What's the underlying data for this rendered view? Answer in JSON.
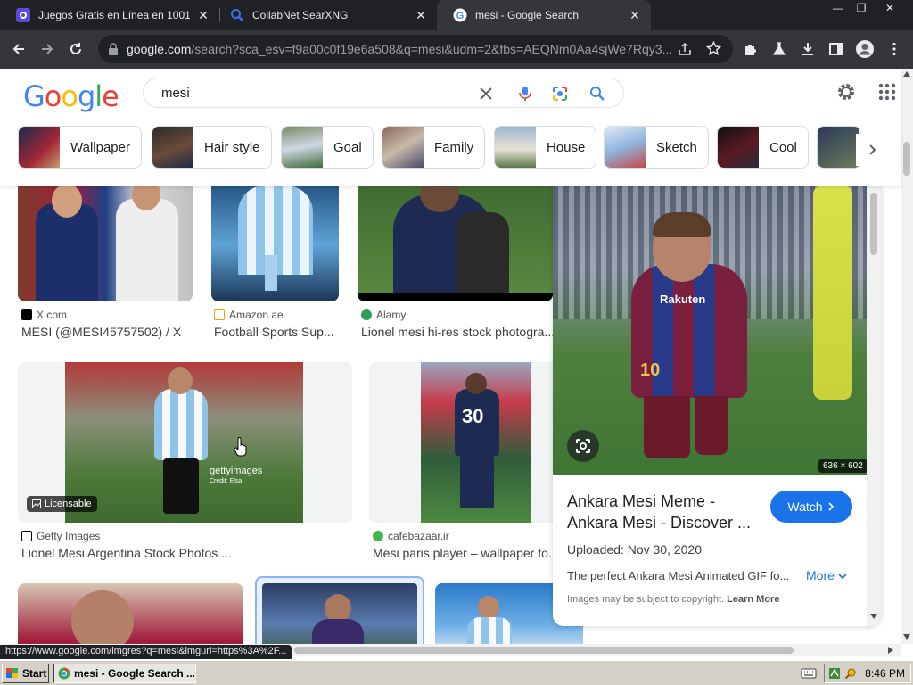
{
  "browser": {
    "tabs": [
      {
        "title": "Juegos Gratis en Línea en 1001juegos",
        "active": false
      },
      {
        "title": "CollabNet SearXNG",
        "active": false
      },
      {
        "title": "mesi - Google Search",
        "active": true
      }
    ],
    "url_host": "google.com",
    "url_rest": "/search?sca_esv=f9a00c0f19e6a508&q=mesi&udm=2&fbs=AEQNm0Aa4sjWe7Rqy3...",
    "status_url": "https://www.google.com/imgres?q=mesi&imgurl=https%3A%2F..."
  },
  "google": {
    "logo_text": "Google",
    "query": "mesi",
    "chips": [
      "Wallpaper",
      "Hair style",
      "Goal",
      "Family",
      "House",
      "Sketch",
      "Cool"
    ]
  },
  "results": [
    {
      "source": "X.com",
      "title": "MESI (@MESI45757502) / X"
    },
    {
      "source": "Amazon.ae",
      "title": "Football Sports Sup..."
    },
    {
      "source": "Alamy",
      "title": "Lionel mesi hi-res stock photogra..."
    },
    {
      "source": "Getty Images",
      "title": "Lionel Mesi Argentina Stock Photos ...",
      "badge": "Licensable",
      "watermark": "gettyimages",
      "credit": "Credit: Elsa"
    },
    {
      "source": "cafebazaar.ir",
      "title": "Mesi paris player – wallpaper fo..."
    }
  ],
  "preview": {
    "dimensions": "636 × 602",
    "title": "Ankara Mesi Meme - Ankara Mesi - Discover ...",
    "watch_label": "Watch",
    "uploaded": "Uploaded: Nov 30, 2020",
    "description": "The perfect Ankara Mesi Animated GIF fo...",
    "more_label": "More",
    "copyright": "Images may be subject to copyright.",
    "learn_more": "Learn More",
    "jersey_sponsor": "Rakuten",
    "jersey_number": "10"
  },
  "taskbar": {
    "start_label": "Start",
    "task_label": "mesi - Google Search ...",
    "clock": "8:46 PM"
  },
  "colors": {
    "accent": "#1a73e8",
    "chrome_dark": "#202124",
    "toolbar": "#35363a"
  }
}
